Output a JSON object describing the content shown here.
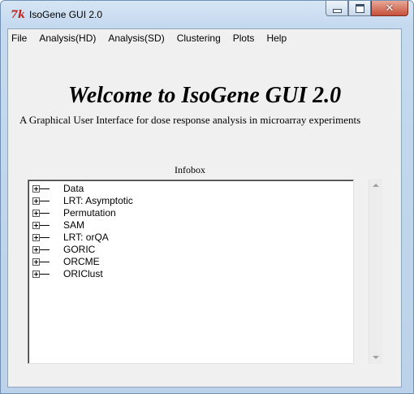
{
  "window": {
    "title": "IsoGene GUI 2.0",
    "icon": "tk-feather-icon",
    "controls": [
      "minimize-icon",
      "maximize-icon",
      "close-icon"
    ],
    "close_glyph": "✕"
  },
  "menubar": {
    "items": [
      "File",
      "Analysis(HD)",
      "Analysis(SD)",
      "Clustering",
      "Plots",
      "Help"
    ]
  },
  "main": {
    "welcome": "Welcome to IsoGene GUI 2.0",
    "subtitle": "A Graphical User Interface for dose response analysis in microarray experiments",
    "infobox_label": "Infobox"
  },
  "infobox": {
    "items": [
      "Data",
      "LRT: Asymptotic",
      "Permutation",
      "SAM",
      "LRT: orQA",
      "GORIC",
      "ORCME",
      "ORIClust"
    ]
  },
  "colors": {
    "accent": "#c0221a",
    "close": "#c7503a",
    "client": "#f0f0f0"
  }
}
